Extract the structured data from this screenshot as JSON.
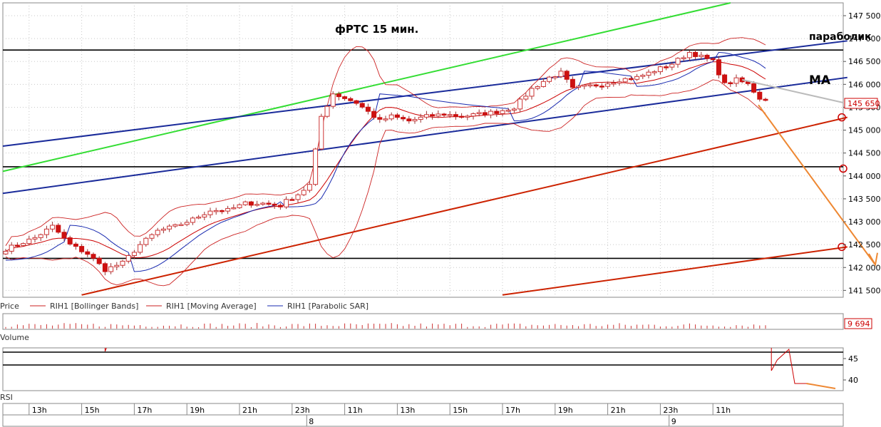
{
  "chart_data": {
    "type": "candlestick",
    "title": "фРТС   15 мин.",
    "annotations": {
      "parabolic": "параболик",
      "ma": "МА"
    },
    "price_axis": {
      "ylim": [
        141350,
        147780
      ],
      "ticks": [
        "147 500",
        "147 000",
        "146 500",
        "146 000",
        "145 500",
        "145 000",
        "144 500",
        "144 000",
        "143 500",
        "143 000",
        "142 500",
        "142 000",
        "141 500"
      ],
      "tick_values": [
        147500,
        147000,
        146500,
        146000,
        145500,
        145000,
        144500,
        144000,
        143500,
        143000,
        142500,
        142000,
        141500
      ],
      "last_price_label": "145 650",
      "last_price": 145650
    },
    "time_axis": {
      "hour_labels": [
        "13h",
        "15h",
        "17h",
        "19h",
        "21h",
        "23h",
        "11h",
        "13h",
        "15h",
        "17h",
        "19h",
        "21h",
        "23h",
        "11h"
      ],
      "hour_positions": [
        4,
        13,
        22,
        31,
        40,
        49,
        58,
        67,
        76,
        85,
        94,
        103,
        112,
        121
      ],
      "day_labels": [
        "8",
        "9"
      ],
      "day_positions": [
        51.5,
        113.5
      ],
      "bar_count": 142
    },
    "legend": [
      "Price",
      "RIH1 [Bollinger Bands]",
      "RIH1 [Moving Average]",
      "RIH1 [Parabolic SAR]"
    ],
    "volume_panel": {
      "label": "Volume",
      "last_label": "9 694",
      "last_value": 9694
    },
    "rsi_panel": {
      "label": "RSI",
      "ticks": [
        "45",
        "40"
      ],
      "tick_values": [
        45,
        40
      ],
      "levels": [
        46.5,
        43.5
      ],
      "ylim": [
        37.5,
        47.5
      ]
    },
    "horizontal_levels": [
      146750,
      144200,
      142200
    ],
    "price_anchors": [
      [
        0,
        142400
      ],
      [
        5,
        142650
      ],
      [
        8,
        142900
      ],
      [
        11,
        142500
      ],
      [
        14,
        142300
      ],
      [
        17,
        141950
      ],
      [
        20,
        142100
      ],
      [
        23,
        142500
      ],
      [
        26,
        142800
      ],
      [
        29,
        142900
      ],
      [
        32,
        143050
      ],
      [
        35,
        143250
      ],
      [
        38,
        143250
      ],
      [
        41,
        143400
      ],
      [
        44,
        143400
      ],
      [
        47,
        143350
      ],
      [
        48,
        143450
      ],
      [
        50,
        143600
      ],
      [
        52,
        143800
      ],
      [
        54,
        145300
      ],
      [
        56,
        145800
      ],
      [
        58,
        145700
      ],
      [
        60,
        145600
      ],
      [
        62,
        145400
      ],
      [
        64,
        145200
      ],
      [
        66,
        145300
      ],
      [
        69,
        145200
      ],
      [
        72,
        145300
      ],
      [
        75,
        145350
      ],
      [
        78,
        145300
      ],
      [
        81,
        145350
      ],
      [
        84,
        145400
      ],
      [
        87,
        145500
      ],
      [
        90,
        145900
      ],
      [
        93,
        146150
      ],
      [
        95,
        146250
      ],
      [
        97,
        145900
      ],
      [
        99,
        145950
      ],
      [
        102,
        146000
      ],
      [
        105,
        146100
      ],
      [
        108,
        146150
      ],
      [
        111,
        146300
      ],
      [
        114,
        146450
      ],
      [
        117,
        146700
      ],
      [
        119,
        146600
      ],
      [
        121,
        146500
      ],
      [
        123,
        146000
      ],
      [
        125,
        146100
      ],
      [
        127,
        146000
      ],
      [
        129,
        145700
      ],
      [
        130,
        145650
      ]
    ],
    "colors": {
      "candle_up": "#cc3333",
      "candle_down": "#cc1111",
      "bollinger": "#cc2222",
      "moving_average": "#cc0000",
      "parabolic_sar": "#1a2bb0",
      "trend_blue": "#1a2b9a",
      "trend_green": "#33dd33",
      "trend_red": "#cc2200",
      "level": "#000000",
      "forecast": "#ee8833",
      "projection": "#bbbbbb"
    }
  }
}
